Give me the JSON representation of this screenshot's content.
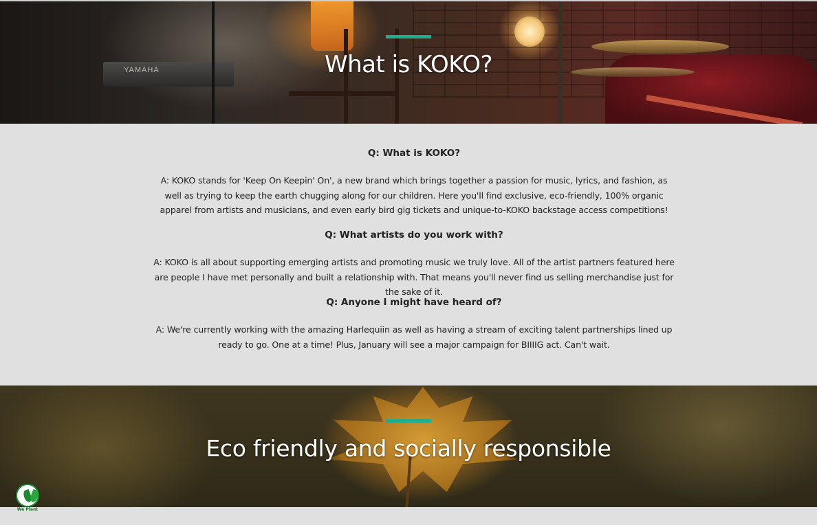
{
  "hero_top": {
    "title": "What is KOKO?",
    "accent_color": "#1fae8c",
    "background_image": "stage-instruments-photo",
    "photo_text": "YAMAHA"
  },
  "faq": {
    "items": [
      {
        "question": "Q: What is KOKO?",
        "answer": "A: KOKO stands for 'Keep On Keepin' On', a new brand which brings together a passion for music, lyrics, and fashion, as well as trying to keep the earth chugging along for our children. Here you'll find exclusive, eco-friendly, 100% organic apparel from artists and musicians, and even early bird gig tickets and unique-to-KOKO backstage access competitions!"
      },
      {
        "question": "Q: What artists do you work with?",
        "answer": "A: KOKO is all about supporting emerging artists and promoting music we truly love. All of the artist partners featured here are people I have met personally and built a relationship with. That means you'll never find us selling merchandise just for the sake of it."
      },
      {
        "question": "Q: Anyone I might have heard of?",
        "answer": "A: We're currently working with the amazing Harlequiin as well as having a stream of exciting talent partnerships lined up ready to go. One at a time! Plus, January will see a major campaign for BIIIIG act. Can't wait."
      }
    ]
  },
  "hero_bottom": {
    "title": "Eco friendly and socially responsible",
    "accent_color": "#1fae8c",
    "background_image": "autumn-maple-leaf-photo"
  },
  "badge": {
    "label": "We Plant",
    "icon": "sprout-leaf-icon"
  }
}
